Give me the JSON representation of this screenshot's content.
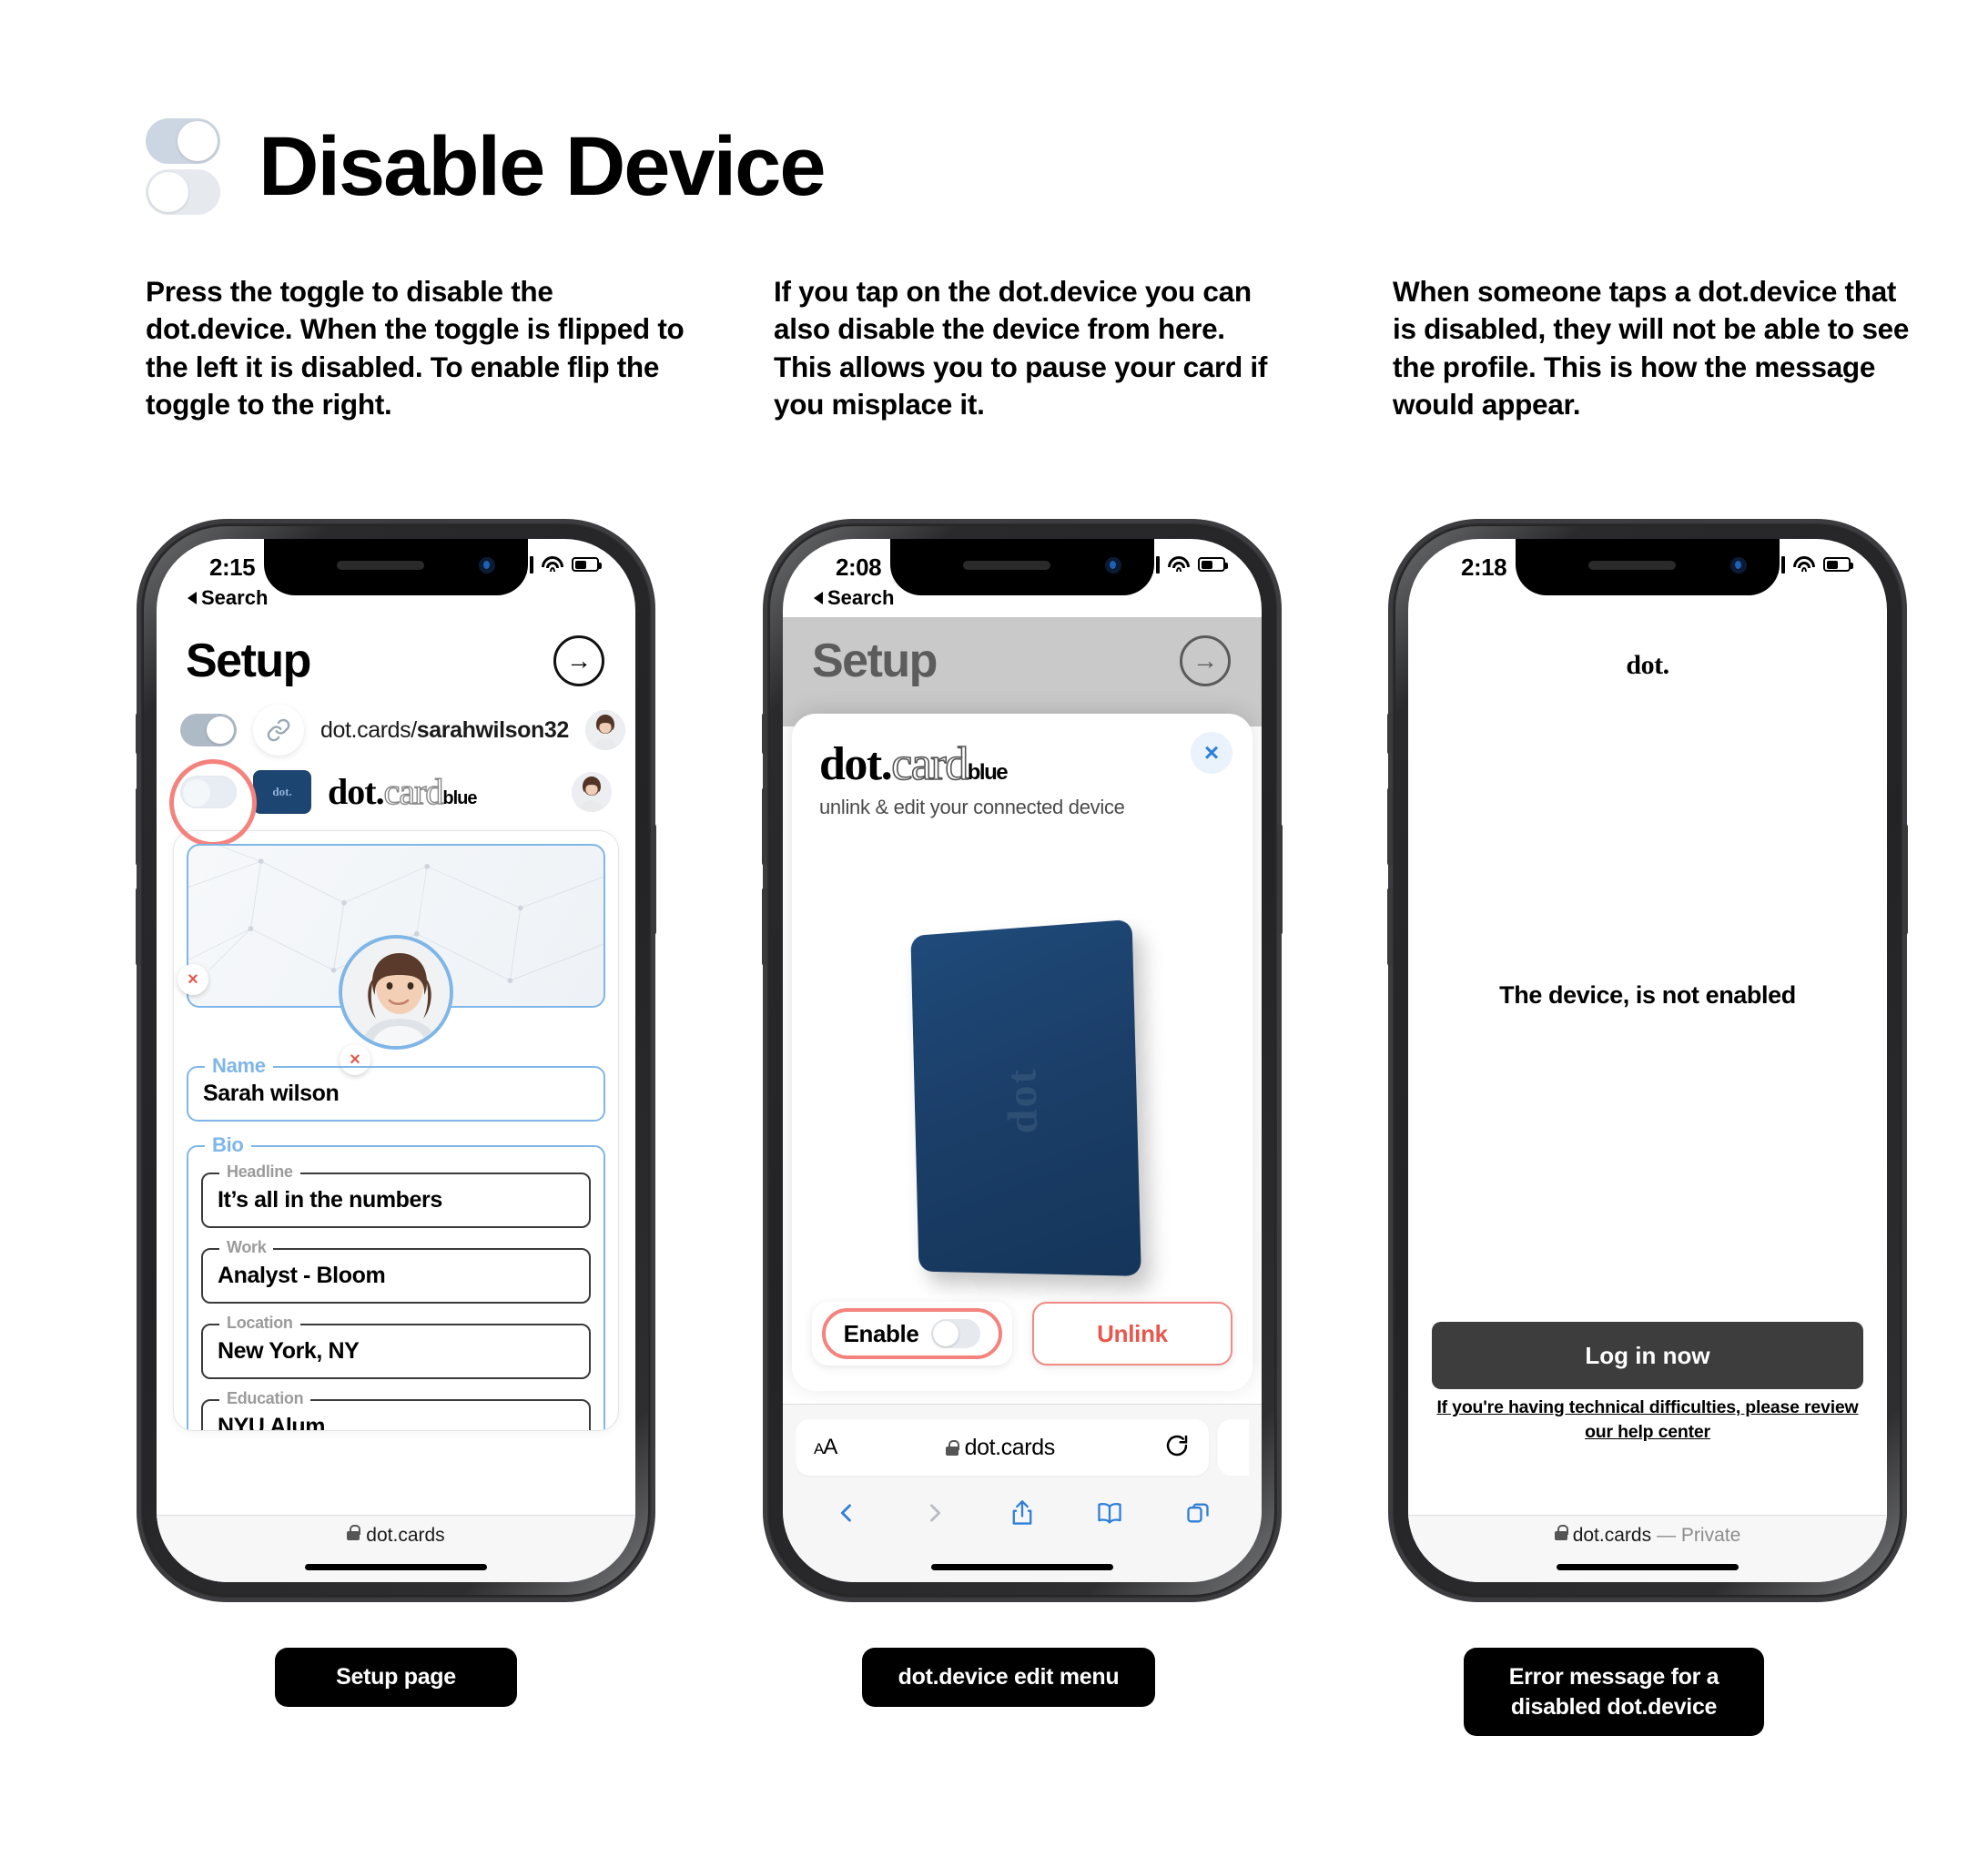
{
  "header": {
    "title": "Disable Device"
  },
  "captions": [
    "Press the toggle to disable the dot.device. When the toggle is flipped to the left it is disabled. To enable flip the toggle to the right.",
    "If you tap on the dot.device you can also disable the device from here. This allows you to pause your card if you misplace it.",
    "When someone taps a dot.device that is disabled, they will not be able to see the profile. This is how the message would appear."
  ],
  "phone1": {
    "status": {
      "time": "2:15",
      "back": "Search"
    },
    "setup": {
      "title": "Setup",
      "next_icon": "→"
    },
    "rows": [
      {
        "toggle": "on",
        "icon": "link-icon",
        "label_plain": "dot.cards/",
        "label_bold": "sarahwilson32"
      },
      {
        "toggle": "off",
        "icon": "card-icon",
        "chip_text": "dot.",
        "brand_1": "dot.",
        "brand_2": "card",
        "brand_3": "blue"
      }
    ],
    "profile": {
      "name_label": "Name",
      "name_value": "Sarah wilson",
      "bio_label": "Bio",
      "fields": [
        {
          "label": "Headline",
          "value": "It’s all in the numbers"
        },
        {
          "label": "Work",
          "value": "Analyst - Bloom"
        },
        {
          "label": "Location",
          "value": "New York, NY"
        },
        {
          "label": "Education",
          "value": "NYU Alum"
        }
      ]
    },
    "footer_url": "dot.cards"
  },
  "phone2": {
    "status": {
      "time": "2:08",
      "back": "Search"
    },
    "setup": {
      "title": "Setup",
      "next_icon": "→"
    },
    "modal": {
      "close_icon": "×",
      "title_1": "dot.",
      "title_2": "card",
      "title_3": "blue",
      "subtitle": "unlink & edit your connected device",
      "card_mark": "dot",
      "enable_label": "Enable",
      "enable_state": "off",
      "unlink_label": "Unlink"
    },
    "safari": {
      "aa": "AA",
      "url": "dot.cards",
      "reload_icon": "↻"
    }
  },
  "phone3": {
    "status": {
      "time": "2:18"
    },
    "logo": "dot.",
    "message": "The device, is not enabled",
    "cta": "Log in now",
    "help": "If you're having technical difficulties, please review our help center",
    "footer_url": "dot.cards",
    "footer_private": "— Private"
  },
  "labels": [
    "Setup page",
    "dot.device edit menu",
    "Error message for a disabled dot.device"
  ],
  "colors": {
    "accent_red": "#f4827d",
    "card_blue": "#1d4571",
    "field_blue": "#7fb6e8",
    "link_blue": "#2f7fd8"
  }
}
